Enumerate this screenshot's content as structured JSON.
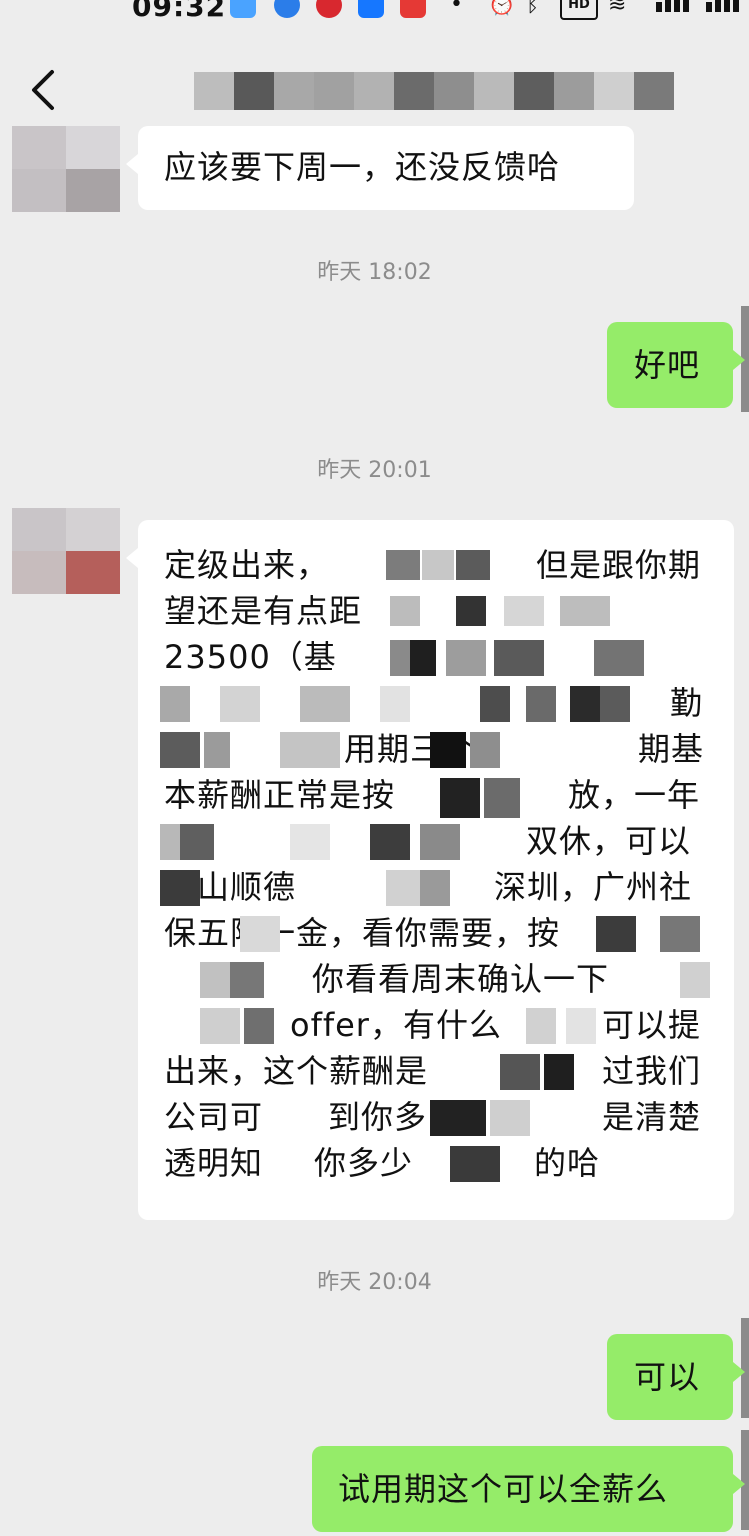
{
  "status_bar": {
    "time": "09:32",
    "badge": "HD",
    "icons": [
      "weather-icon",
      "app-icon",
      "app-icon",
      "alipay-icon",
      "news-icon",
      "more-dot-icon",
      "alarm-icon",
      "bluetooth-icon",
      "hd-badge",
      "wifi-icon",
      "signal-icon",
      "signal-icon"
    ]
  },
  "nav": {
    "back_icon": "chevron-left-icon"
  },
  "messages": [
    {
      "side": "in",
      "text": "应该要下周一，还没反馈哈"
    },
    {
      "side": "time",
      "text": "昨天 18:02"
    },
    {
      "side": "out",
      "text": "好吧"
    },
    {
      "side": "time",
      "text": "昨天 20:01"
    },
    {
      "side": "in",
      "text": "定级出来，\n望还是有点距\n23500（基\n\n\n本薪酬正常是按\n薪，\n佛山顺德\n保五险一金，看你需要，按\n\n\n出来，这个薪酬是\n公司可\n透明知"
    },
    {
      "side": "time",
      "text": "昨天 20:04"
    },
    {
      "side": "out",
      "text": "可以"
    },
    {
      "side": "out",
      "text": "试用期这个可以全薪么"
    }
  ],
  "blurred_fragments": {
    "line1_right": "但是跟你期",
    "line4_right": "勤",
    "line5_mid": "用期三个",
    "line5_right": "期基",
    "line6_right": "放，一年",
    "line7_right": "双休，可以",
    "line8_right": "深圳，广州社",
    "line10_mid": "你看看周末确认一下",
    "line11_mid": "offer，有什么",
    "line11_right": "可以提",
    "line12_right": "过我们",
    "line13_mid": "到你多",
    "line13_right": "是清楚",
    "line14_mid": "你多少",
    "line14_right": "的哈"
  },
  "colors": {
    "background": "#ededed",
    "bubble_in": "#ffffff",
    "bubble_out": "#95ec69",
    "timestamp": "#8c8c8c"
  }
}
